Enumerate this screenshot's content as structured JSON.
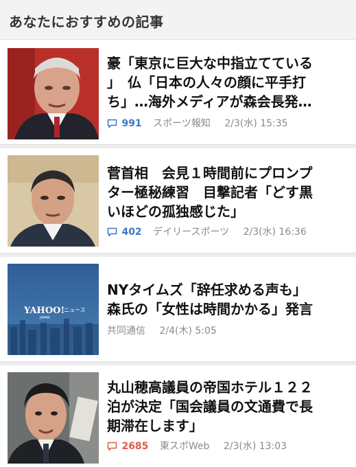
{
  "section": {
    "title": "あなたにおすすめの記事"
  },
  "articles": [
    {
      "headline": "豪「東京に巨大な中指立てている\n」　仏「日本の人々の顔に平手打\nち」…海外メディアが森会長発…",
      "comments": "991",
      "comment_color": "#3a78c8",
      "source": "スポーツ報知",
      "datetime": "2/3(水) 15:35",
      "thumbnail_icon": "news-photo-elderly-man"
    },
    {
      "headline": "菅首相　会見１時間前にプロンプ\nター極秘練習　目撃記者「どす黒\nいほどの孤独感じた」",
      "comments": "402",
      "comment_color": "#3a78c8",
      "source": "デイリースポーツ",
      "datetime": "2/3(水) 16:36",
      "thumbnail_icon": "news-photo-politician"
    },
    {
      "headline": "NYタイムズ「辞任求める声も」\n森氏の「女性は時間かかる」発言",
      "comments": "",
      "comment_color": "",
      "source": "共同通信",
      "datetime": "2/4(木) 5:05",
      "thumbnail_icon": "yahoo-news-logo",
      "thumbnail_logo_text": "YAHOO!",
      "thumbnail_logo_sub": "ニュース",
      "thumbnail_logo_small": "JAPAN"
    },
    {
      "headline": "丸山穂高議員の帝国ホテル１２２\n泊が決定「国会議員の文通費で長\n期滞在します」",
      "comments": "2685",
      "comment_color": "#e05a4a",
      "source": "東スポWeb",
      "datetime": "2/3(水) 13:03",
      "thumbnail_icon": "news-photo-young-man"
    }
  ]
}
